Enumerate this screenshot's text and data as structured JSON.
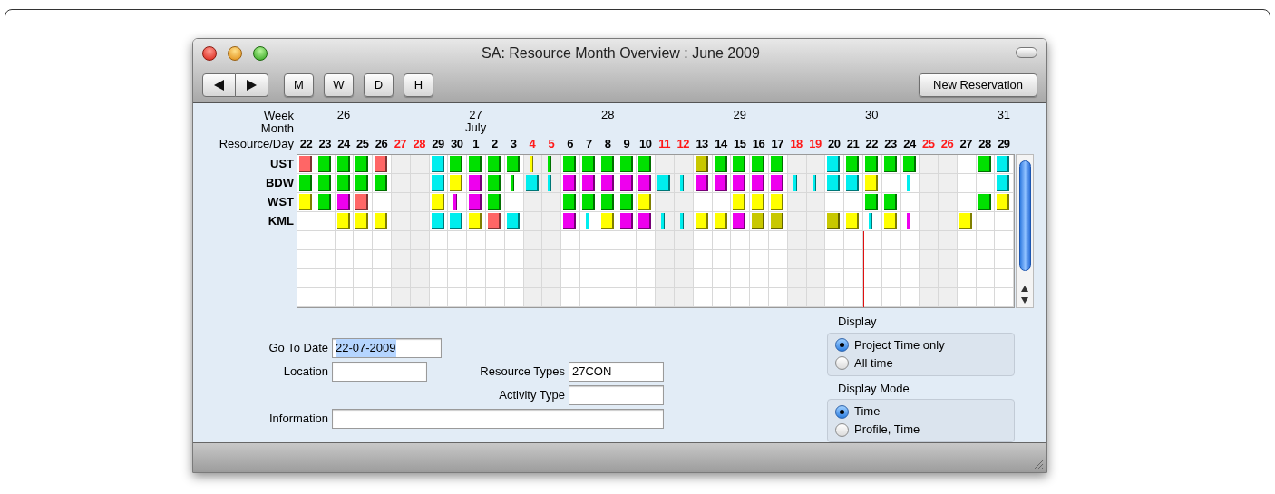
{
  "window": {
    "title": "SA: Resource Month Overview : June 2009"
  },
  "toolbar": {
    "view_buttons": [
      "M",
      "W",
      "D",
      "H"
    ],
    "new_reservation": "New Reservation"
  },
  "schedule": {
    "header_labels": [
      "Week",
      "Month",
      "Resource/Day"
    ],
    "days": [
      {
        "label": "22",
        "weekend": false,
        "today": false
      },
      {
        "label": "23",
        "weekend": false,
        "today": false
      },
      {
        "label": "24",
        "weekend": false,
        "today": false,
        "week": "26"
      },
      {
        "label": "25",
        "weekend": false,
        "today": false
      },
      {
        "label": "26",
        "weekend": false,
        "today": false
      },
      {
        "label": "27",
        "weekend": true,
        "today": false
      },
      {
        "label": "28",
        "weekend": true,
        "today": false
      },
      {
        "label": "29",
        "weekend": false,
        "today": false
      },
      {
        "label": "30",
        "weekend": false,
        "today": false
      },
      {
        "label": "1",
        "weekend": false,
        "today": false,
        "week": "27",
        "month": "July"
      },
      {
        "label": "2",
        "weekend": false,
        "today": false
      },
      {
        "label": "3",
        "weekend": false,
        "today": false
      },
      {
        "label": "4",
        "weekend": true,
        "today": false
      },
      {
        "label": "5",
        "weekend": true,
        "today": false
      },
      {
        "label": "6",
        "weekend": false,
        "today": false
      },
      {
        "label": "7",
        "weekend": false,
        "today": false
      },
      {
        "label": "8",
        "weekend": false,
        "today": false,
        "week": "28"
      },
      {
        "label": "9",
        "weekend": false,
        "today": false
      },
      {
        "label": "10",
        "weekend": false,
        "today": false
      },
      {
        "label": "11",
        "weekend": true,
        "today": false
      },
      {
        "label": "12",
        "weekend": true,
        "today": false
      },
      {
        "label": "13",
        "weekend": false,
        "today": false
      },
      {
        "label": "14",
        "weekend": false,
        "today": false
      },
      {
        "label": "15",
        "weekend": false,
        "today": false,
        "week": "29"
      },
      {
        "label": "16",
        "weekend": false,
        "today": false
      },
      {
        "label": "17",
        "weekend": false,
        "today": false
      },
      {
        "label": "18",
        "weekend": true,
        "today": false
      },
      {
        "label": "19",
        "weekend": true,
        "today": false
      },
      {
        "label": "20",
        "weekend": false,
        "today": false
      },
      {
        "label": "21",
        "weekend": false,
        "today": false
      },
      {
        "label": "22",
        "weekend": false,
        "today": true,
        "week": "30"
      },
      {
        "label": "23",
        "weekend": false,
        "today": false
      },
      {
        "label": "24",
        "weekend": false,
        "today": false
      },
      {
        "label": "25",
        "weekend": true,
        "today": false
      },
      {
        "label": "26",
        "weekend": true,
        "today": false
      },
      {
        "label": "27",
        "weekend": false,
        "today": false
      },
      {
        "label": "28",
        "weekend": false,
        "today": false
      },
      {
        "label": "29",
        "weekend": false,
        "today": false,
        "week": "31"
      }
    ],
    "resources": [
      {
        "name": "UST",
        "bookings": [
          {
            "kind": "block",
            "color": "#ff6666"
          },
          {
            "kind": "block",
            "color": "#00e000"
          },
          {
            "kind": "block",
            "color": "#00e000"
          },
          {
            "kind": "block",
            "color": "#00e000"
          },
          {
            "kind": "block",
            "color": "#ff6666"
          },
          {
            "kind": "empty"
          },
          {
            "kind": "empty"
          },
          {
            "kind": "block",
            "color": "#00eeee"
          },
          {
            "kind": "block",
            "color": "#00e000"
          },
          {
            "kind": "block",
            "color": "#00e000"
          },
          {
            "kind": "block",
            "color": "#00e000"
          },
          {
            "kind": "block",
            "color": "#00e000"
          },
          {
            "kind": "thin",
            "color": "#ffff00"
          },
          {
            "kind": "thin",
            "color": "#00e000"
          },
          {
            "kind": "block",
            "color": "#00e000"
          },
          {
            "kind": "block",
            "color": "#00e000"
          },
          {
            "kind": "block",
            "color": "#00e000"
          },
          {
            "kind": "block",
            "color": "#00e000"
          },
          {
            "kind": "block",
            "color": "#00e000"
          },
          {
            "kind": "empty"
          },
          {
            "kind": "empty"
          },
          {
            "kind": "block",
            "color": "#c8c800"
          },
          {
            "kind": "block",
            "color": "#00e000"
          },
          {
            "kind": "block",
            "color": "#00e000"
          },
          {
            "kind": "block",
            "color": "#00e000"
          },
          {
            "kind": "block",
            "color": "#00e000"
          },
          {
            "kind": "empty"
          },
          {
            "kind": "empty"
          },
          {
            "kind": "block",
            "color": "#00eeee"
          },
          {
            "kind": "block",
            "color": "#00e000"
          },
          {
            "kind": "block",
            "color": "#00e000"
          },
          {
            "kind": "block",
            "color": "#00e000"
          },
          {
            "kind": "block",
            "color": "#00e000"
          },
          {
            "kind": "empty"
          },
          {
            "kind": "empty"
          },
          {
            "kind": "empty"
          },
          {
            "kind": "block",
            "color": "#00e000"
          },
          {
            "kind": "block",
            "color": "#00eeee"
          }
        ]
      },
      {
        "name": "BDW",
        "bookings": [
          {
            "kind": "block",
            "color": "#00e000"
          },
          {
            "kind": "block",
            "color": "#00e000"
          },
          {
            "kind": "block",
            "color": "#00e000"
          },
          {
            "kind": "block",
            "color": "#00e000"
          },
          {
            "kind": "block",
            "color": "#00e000"
          },
          {
            "kind": "empty"
          },
          {
            "kind": "empty"
          },
          {
            "kind": "block",
            "color": "#00eeee"
          },
          {
            "kind": "block",
            "color": "#ffff00"
          },
          {
            "kind": "block",
            "color": "#ee00ee"
          },
          {
            "kind": "block",
            "color": "#00e000"
          },
          {
            "kind": "thin",
            "color": "#00e000"
          },
          {
            "kind": "block",
            "color": "#00eeee"
          },
          {
            "kind": "thin",
            "color": "#00eeee"
          },
          {
            "kind": "block",
            "color": "#ee00ee"
          },
          {
            "kind": "block",
            "color": "#ee00ee"
          },
          {
            "kind": "block",
            "color": "#ee00ee"
          },
          {
            "kind": "block",
            "color": "#ee00ee"
          },
          {
            "kind": "block",
            "color": "#ee00ee"
          },
          {
            "kind": "block",
            "color": "#00eeee"
          },
          {
            "kind": "thin",
            "color": "#00eeee"
          },
          {
            "kind": "block",
            "color": "#ee00ee"
          },
          {
            "kind": "block",
            "color": "#ee00ee"
          },
          {
            "kind": "block",
            "color": "#ee00ee"
          },
          {
            "kind": "block",
            "color": "#ee00ee"
          },
          {
            "kind": "block",
            "color": "#ee00ee"
          },
          {
            "kind": "thin",
            "color": "#00eeee"
          },
          {
            "kind": "thin",
            "color": "#00eeee"
          },
          {
            "kind": "block",
            "color": "#00eeee"
          },
          {
            "kind": "block",
            "color": "#00eeee"
          },
          {
            "kind": "block",
            "color": "#ffff00"
          },
          {
            "kind": "empty"
          },
          {
            "kind": "thin",
            "color": "#00eeee"
          },
          {
            "kind": "empty"
          },
          {
            "kind": "empty"
          },
          {
            "kind": "empty"
          },
          {
            "kind": "empty"
          },
          {
            "kind": "block",
            "color": "#00eeee"
          }
        ]
      },
      {
        "name": "WST",
        "bookings": [
          {
            "kind": "block",
            "color": "#ffff00"
          },
          {
            "kind": "block",
            "color": "#00e000"
          },
          {
            "kind": "block",
            "color": "#ee00ee"
          },
          {
            "kind": "block",
            "color": "#ff6666"
          },
          {
            "kind": "empty"
          },
          {
            "kind": "empty"
          },
          {
            "kind": "empty"
          },
          {
            "kind": "block",
            "color": "#ffff00"
          },
          {
            "kind": "thin",
            "color": "#ee00ee"
          },
          {
            "kind": "block",
            "color": "#ee00ee"
          },
          {
            "kind": "block",
            "color": "#00e000"
          },
          {
            "kind": "empty"
          },
          {
            "kind": "empty"
          },
          {
            "kind": "empty"
          },
          {
            "kind": "block",
            "color": "#00e000"
          },
          {
            "kind": "block",
            "color": "#00e000"
          },
          {
            "kind": "block",
            "color": "#00e000"
          },
          {
            "kind": "block",
            "color": "#00e000"
          },
          {
            "kind": "block",
            "color": "#ffff00"
          },
          {
            "kind": "empty"
          },
          {
            "kind": "empty"
          },
          {
            "kind": "empty"
          },
          {
            "kind": "empty"
          },
          {
            "kind": "block",
            "color": "#ffff00"
          },
          {
            "kind": "block",
            "color": "#ffff00"
          },
          {
            "kind": "block",
            "color": "#ffff00"
          },
          {
            "kind": "empty"
          },
          {
            "kind": "empty"
          },
          {
            "kind": "empty"
          },
          {
            "kind": "empty"
          },
          {
            "kind": "block",
            "color": "#00e000"
          },
          {
            "kind": "block",
            "color": "#00e000"
          },
          {
            "kind": "empty"
          },
          {
            "kind": "empty"
          },
          {
            "kind": "empty"
          },
          {
            "kind": "empty"
          },
          {
            "kind": "block",
            "color": "#00e000"
          },
          {
            "kind": "block",
            "color": "#ffff00"
          }
        ]
      },
      {
        "name": "KML",
        "bookings": [
          {
            "kind": "empty"
          },
          {
            "kind": "empty"
          },
          {
            "kind": "block",
            "color": "#ffff00"
          },
          {
            "kind": "block",
            "color": "#ffff00"
          },
          {
            "kind": "block",
            "color": "#ffff00"
          },
          {
            "kind": "empty"
          },
          {
            "kind": "empty"
          },
          {
            "kind": "block",
            "color": "#00eeee"
          },
          {
            "kind": "block",
            "color": "#00eeee"
          },
          {
            "kind": "block",
            "color": "#ffff00"
          },
          {
            "kind": "block",
            "color": "#ff6666"
          },
          {
            "kind": "block",
            "color": "#00eeee"
          },
          {
            "kind": "empty"
          },
          {
            "kind": "empty"
          },
          {
            "kind": "block",
            "color": "#ee00ee"
          },
          {
            "kind": "thin",
            "color": "#00eeee"
          },
          {
            "kind": "block",
            "color": "#ffff00"
          },
          {
            "kind": "block",
            "color": "#ee00ee"
          },
          {
            "kind": "block",
            "color": "#ee00ee"
          },
          {
            "kind": "thin",
            "color": "#00eeee"
          },
          {
            "kind": "thin",
            "color": "#00eeee"
          },
          {
            "kind": "block",
            "color": "#ffff00"
          },
          {
            "kind": "block",
            "color": "#ffff00"
          },
          {
            "kind": "block",
            "color": "#ee00ee"
          },
          {
            "kind": "block",
            "color": "#c8c800"
          },
          {
            "kind": "block",
            "color": "#c8c800"
          },
          {
            "kind": "empty"
          },
          {
            "kind": "empty"
          },
          {
            "kind": "block",
            "color": "#c8c800"
          },
          {
            "kind": "block",
            "color": "#ffff00"
          },
          {
            "kind": "thin",
            "color": "#00eeee"
          },
          {
            "kind": "block",
            "color": "#ffff00"
          },
          {
            "kind": "thin",
            "color": "#ee00ee"
          },
          {
            "kind": "empty"
          },
          {
            "kind": "empty"
          },
          {
            "kind": "block",
            "color": "#ffff00"
          },
          {
            "kind": "empty"
          },
          {
            "kind": "empty"
          }
        ]
      }
    ]
  },
  "form": {
    "go_to_date": {
      "label": "Go To Date",
      "value": "22-07-2009",
      "highlighted": true
    },
    "location": {
      "label": "Location"
    },
    "resource_types": {
      "label": "Resource Types",
      "value": "27CON"
    },
    "activity_type": {
      "label": "Activity Type"
    },
    "information": {
      "label": "Information"
    }
  },
  "option_groups": [
    {
      "title": "Display",
      "options": [
        {
          "label": "Project Time only",
          "selected": true
        },
        {
          "label": "All time",
          "selected": false
        }
      ]
    },
    {
      "title": "Display Mode",
      "options": [
        {
          "label": "Time",
          "selected": true
        },
        {
          "label": "Profile, Time",
          "selected": false
        }
      ]
    }
  ]
}
